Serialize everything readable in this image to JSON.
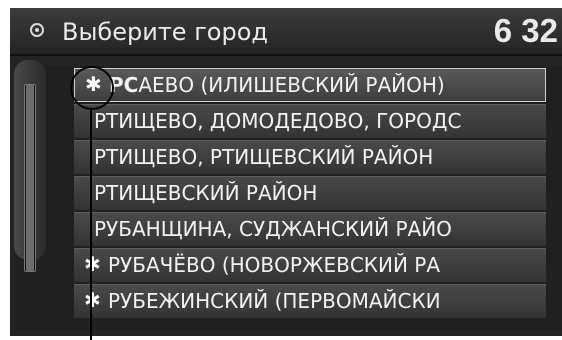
{
  "header": {
    "title": "Выберите город",
    "clock": "6 32",
    "icon": "round-button-icon"
  },
  "list": {
    "items": [
      {
        "star": "✱",
        "bold_prefix": "РС",
        "text": "АЕВО (ИЛИШЕВСКИЙ РАЙОН)",
        "selected": true
      },
      {
        "star": "",
        "bold_prefix": "",
        "text": "РТИЩЕВО, ДОМОДЕДОВО, ГОРОДС",
        "selected": false
      },
      {
        "star": "",
        "bold_prefix": "",
        "text": "РТИЩЕВО, РТИЩЕВСКИЙ РАЙОН",
        "selected": false
      },
      {
        "star": "",
        "bold_prefix": "",
        "text": "РТИЩЕВСКИЙ РАЙОН",
        "selected": false
      },
      {
        "star": "",
        "bold_prefix": "",
        "text": "РУБАНЩИНА, СУДЖАНСКИЙ РАЙО",
        "selected": false
      },
      {
        "star": "✱",
        "bold_prefix": "",
        "text": "РУБАЧЁВО (НОВОРЖЕВСКИЙ РА",
        "selected": false
      },
      {
        "star": "✱",
        "bold_prefix": "",
        "text": "РУБЕЖИНСКИЙ (ПЕРВОМАЙСКИ",
        "selected": false
      }
    ]
  },
  "scrollbar": {
    "position": 0.0
  },
  "colors": {
    "screen_bg": "#242424",
    "row_bg": "#3e3e3e",
    "text": "#f2f2f2"
  }
}
